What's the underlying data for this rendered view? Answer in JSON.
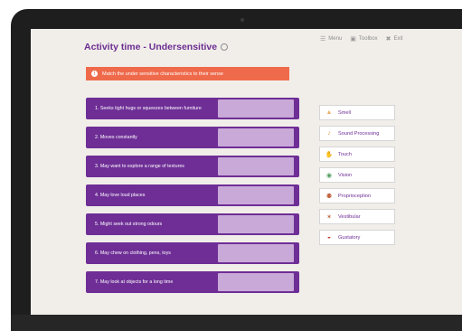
{
  "header": {
    "title": "Activity time - Undersensitive"
  },
  "nav": {
    "menu": "Menu",
    "toolbox": "Toolbox",
    "exit": "Exit"
  },
  "instruction": {
    "icon": "!",
    "text": "Match the under sensitive characteristics to their sense"
  },
  "statements": [
    {
      "label": "1. Seeks tight hugs or squeezes between furniture"
    },
    {
      "label": "2. Moves constantly"
    },
    {
      "label": "3. May want to explore a range of textures"
    },
    {
      "label": "4. May love loud places"
    },
    {
      "label": "5. Might seek out strong odours"
    },
    {
      "label": "6. May chew on clothing, pens, toys"
    },
    {
      "label": "7. May look at objects for a long time"
    }
  ],
  "senses": [
    {
      "label": "Smell",
      "icon": "nose-icon",
      "glyph": "▲",
      "color": "#e9b26b"
    },
    {
      "label": "Sound Processing",
      "icon": "ear-icon",
      "glyph": "♪",
      "color": "#e9a24c"
    },
    {
      "label": "Touch",
      "icon": "hand-icon",
      "glyph": "✋",
      "color": "#e8b77a"
    },
    {
      "label": "Vision",
      "icon": "eye-icon",
      "glyph": "◉",
      "color": "#4e9a5a"
    },
    {
      "label": "Proprioception",
      "icon": "people-icon",
      "glyph": "⚉",
      "color": "#c0623b"
    },
    {
      "label": "Vestibular",
      "icon": "person-spinning-icon",
      "glyph": "✶",
      "color": "#c0623b"
    },
    {
      "label": "Gustatory",
      "icon": "mouth-icon",
      "glyph": "◒",
      "color": "#c33a2d"
    }
  ]
}
